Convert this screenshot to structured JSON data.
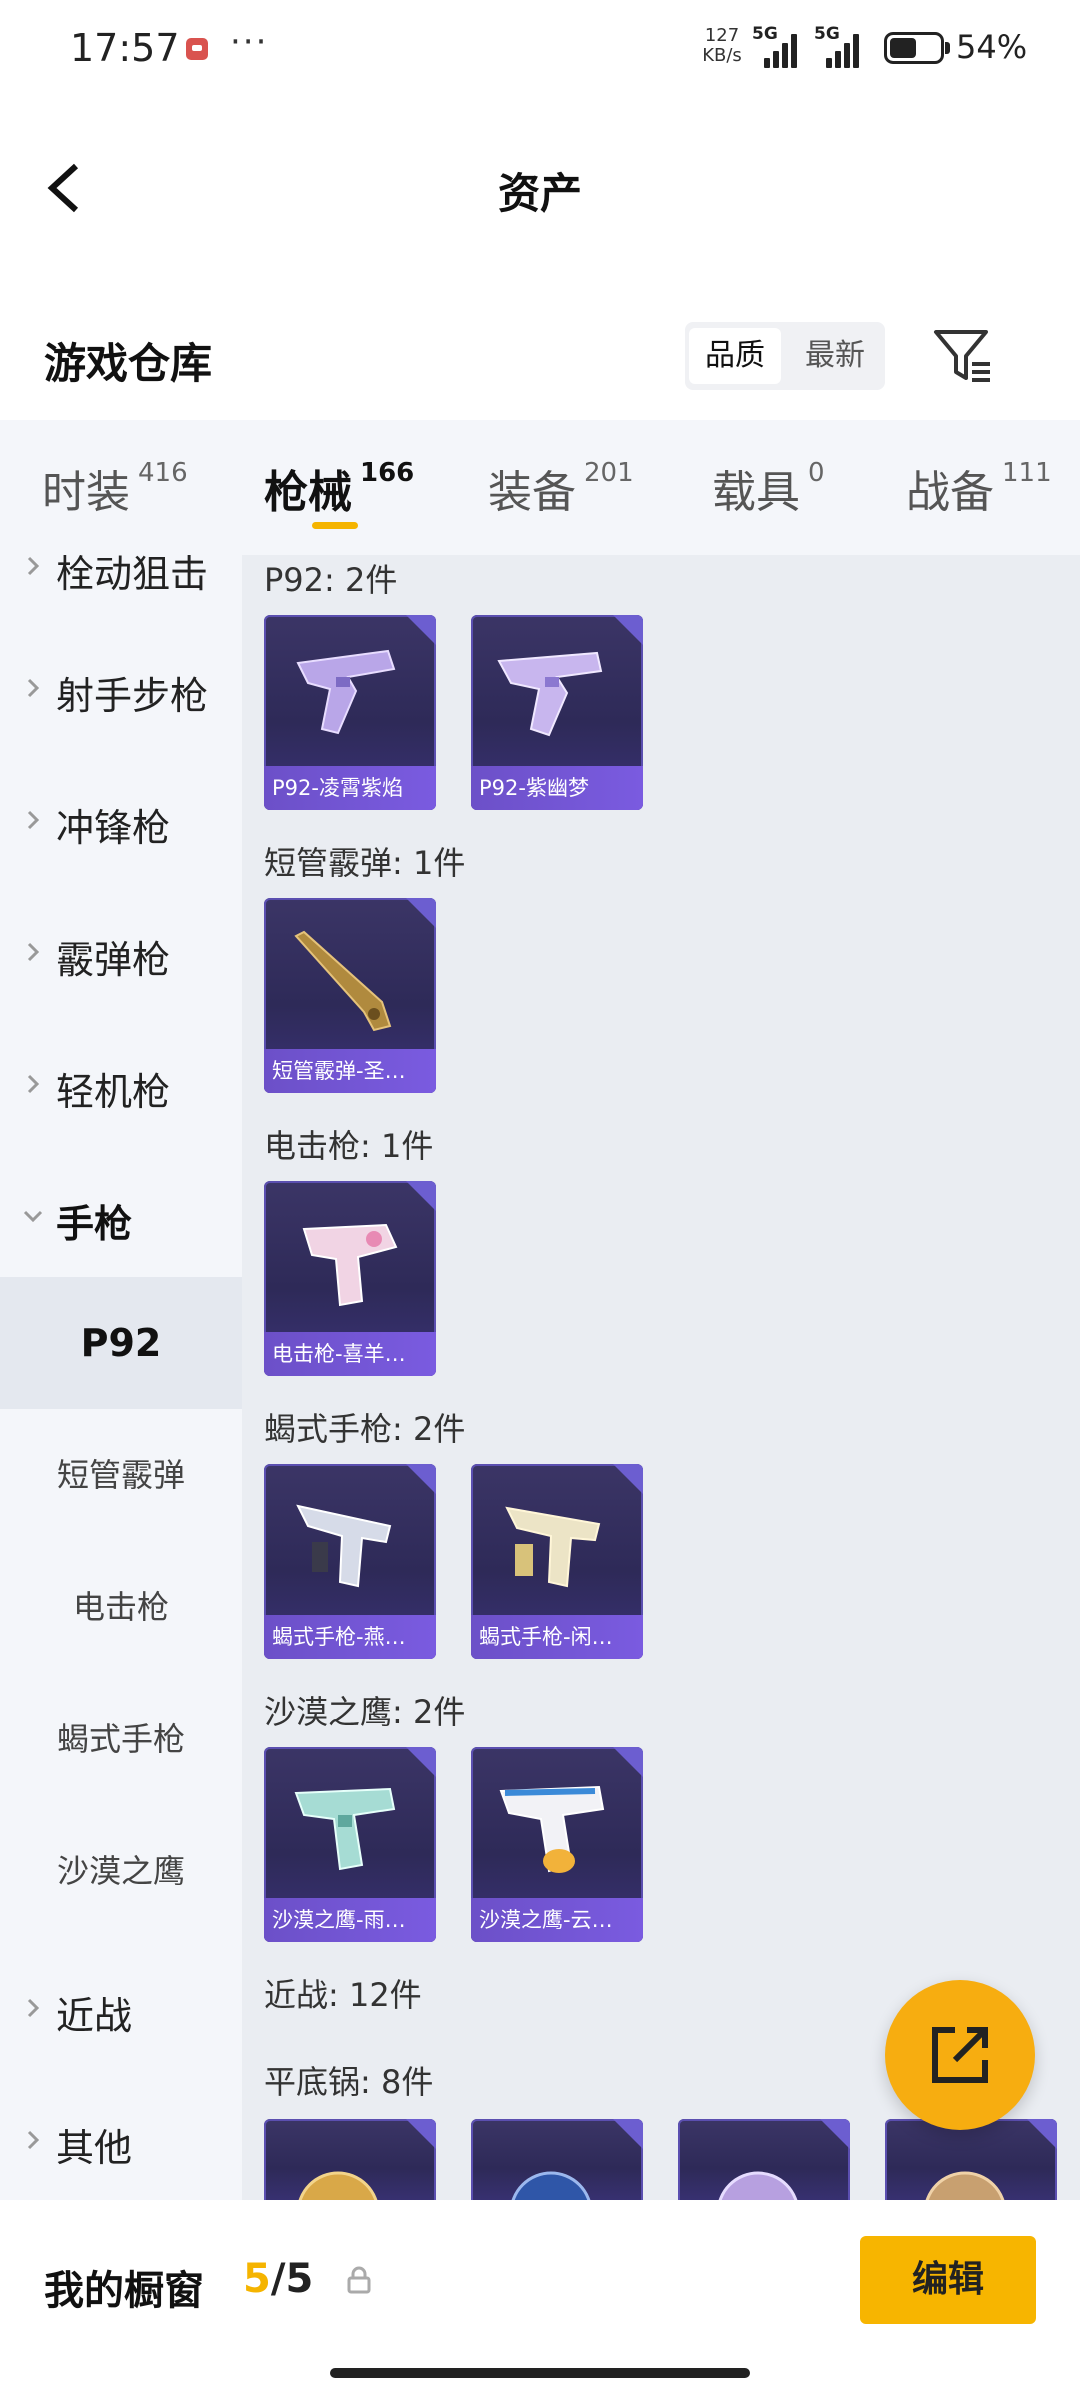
{
  "status_bar": {
    "time": "17:57",
    "more": "···",
    "net_speed_value": "127",
    "net_speed_unit": "KB/s",
    "signal1": "5G",
    "signal2": "5G",
    "battery_level": 0.54,
    "battery_pct": "54%"
  },
  "header": {
    "title": "资产"
  },
  "warehouse": {
    "title": "游戏仓库",
    "sort_options": [
      "品质",
      "最新"
    ],
    "sort_selected": "品质"
  },
  "tabs": [
    {
      "label": "时装",
      "count": "416"
    },
    {
      "label": "枪械",
      "count": "166"
    },
    {
      "label": "装备",
      "count": "201"
    },
    {
      "label": "载具",
      "count": "0"
    },
    {
      "label": "战备",
      "count": "111"
    }
  ],
  "active_tab": "枪械",
  "sidebar": {
    "categories": [
      {
        "label": "射手步枪"
      },
      {
        "label": "冲锋枪"
      },
      {
        "label": "霰弹枪"
      },
      {
        "label": "轻机枪"
      },
      {
        "label": "手枪"
      },
      {
        "label": "近战"
      },
      {
        "label": "其他"
      }
    ],
    "partial_top_label": "栓动狙击",
    "subitems": [
      {
        "label": "P92"
      },
      {
        "label": "短管霰弹"
      },
      {
        "label": "电击枪"
      },
      {
        "label": "蝎式手枪"
      },
      {
        "label": "沙漠之鹰"
      }
    ],
    "selected_subitem": "P92"
  },
  "groups": [
    {
      "title": "P92: 2件",
      "items": [
        {
          "name": "P92-凌霄紫焰"
        },
        {
          "name": "P92-紫幽梦"
        }
      ]
    },
    {
      "title": "短管霰弹: 1件",
      "items": [
        {
          "name": "短管霰弹-圣…"
        }
      ]
    },
    {
      "title": "电击枪: 1件",
      "items": [
        {
          "name": "电击枪-喜羊…"
        }
      ]
    },
    {
      "title": "蝎式手枪: 2件",
      "items": [
        {
          "name": "蝎式手枪-燕…"
        },
        {
          "name": "蝎式手枪-闲…"
        }
      ]
    },
    {
      "title": "沙漠之鹰: 2件",
      "items": [
        {
          "name": "沙漠之鹰-雨…"
        },
        {
          "name": "沙漠之鹰-云…"
        }
      ]
    },
    {
      "title": "近战: 12件",
      "items": []
    },
    {
      "title": "平底锅: 8件",
      "items": []
    }
  ],
  "bottom_bar": {
    "showcase_label": "我的橱窗",
    "count_current": "5",
    "count_sep": "/",
    "count_max": "5",
    "edit_label": "编辑"
  },
  "colors": {
    "accent": "#f5b400",
    "card_bg": "#2e2a58",
    "card_label": "#7a5be0"
  }
}
